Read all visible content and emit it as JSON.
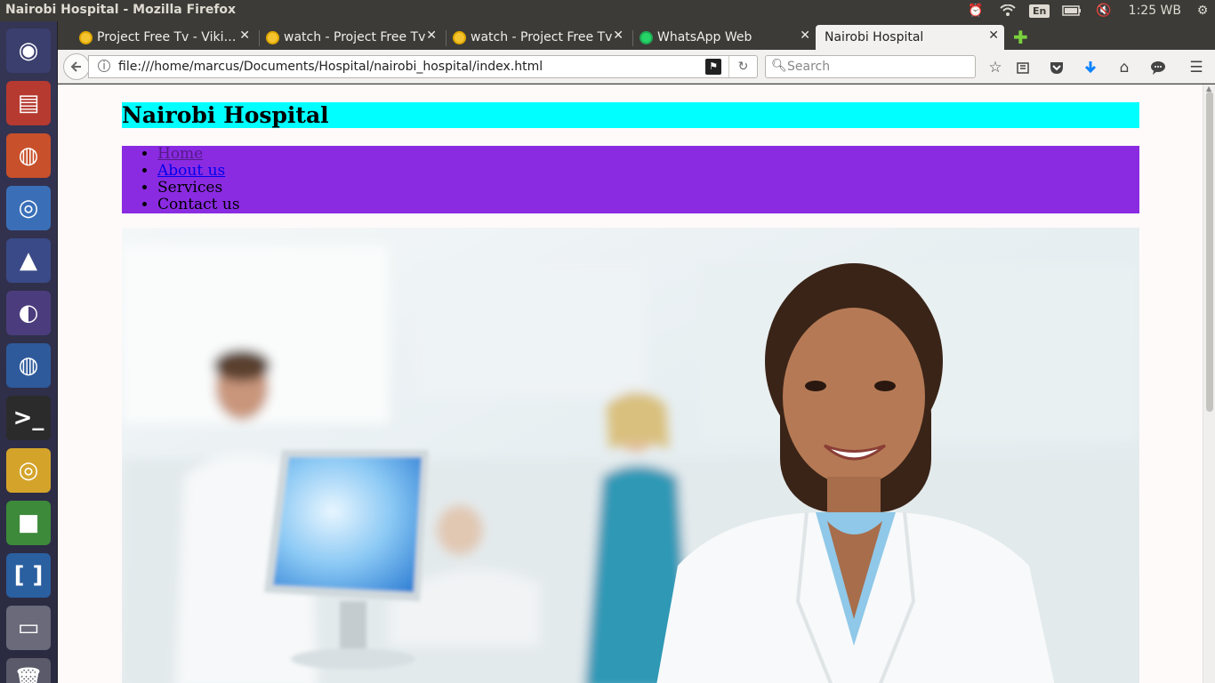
{
  "system": {
    "window_title": "Nairobi Hospital - Mozilla Firefox",
    "language": "En",
    "clock": "1:25 WB"
  },
  "launcher": {
    "items": [
      {
        "name": "ubuntu-dash-icon",
        "color": "#3a3f6e"
      },
      {
        "name": "files-icon",
        "color": "#b63a30"
      },
      {
        "name": "firefox-icon",
        "color": "#c8502a"
      },
      {
        "name": "chromium-icon",
        "color": "#3a6fb8"
      },
      {
        "name": "vlc-icon",
        "color": "#3a4a88"
      },
      {
        "name": "eclipse-icon",
        "color": "#4b3d7d"
      },
      {
        "name": "thunderbird-icon",
        "color": "#2e5a9b"
      },
      {
        "name": "terminal-icon",
        "color": "#2b2b2b"
      },
      {
        "name": "chrome-icon",
        "color": "#d4a42a"
      },
      {
        "name": "cube-app-icon",
        "color": "#3d8a3a"
      },
      {
        "name": "brackets-icon",
        "color": "#2a5fa0"
      },
      {
        "name": "drive-icon",
        "color": "#6a6a7a"
      },
      {
        "name": "trash-icon",
        "color": "#5a5a6a"
      }
    ]
  },
  "tabs": [
    {
      "label": "Project Free Tv - Viki…",
      "favicon": "sun"
    },
    {
      "label": "watch - Project Free Tv",
      "favicon": "sun"
    },
    {
      "label": "watch - Project Free Tv",
      "favicon": "sun"
    },
    {
      "label": "WhatsApp Web",
      "favicon": "whatsapp"
    },
    {
      "label": "Nairobi Hospital",
      "favicon": "none",
      "active": true
    }
  ],
  "navbar": {
    "url": "file:///home/marcus/Documents/Hospital/nairobi_hospital/index.html",
    "search_placeholder": "Search"
  },
  "page": {
    "heading": "Nairobi Hospital",
    "nav": [
      {
        "label": "Home",
        "type": "visited-link"
      },
      {
        "label": "About us",
        "type": "link"
      },
      {
        "label": "Services",
        "type": "text"
      },
      {
        "label": "Contact us",
        "type": "text"
      }
    ],
    "colors": {
      "header_bg": "#00ffff",
      "nav_bg": "#8a2be2",
      "page_bg": "#fffafa"
    },
    "hero_image": "medical-staff-photo"
  }
}
